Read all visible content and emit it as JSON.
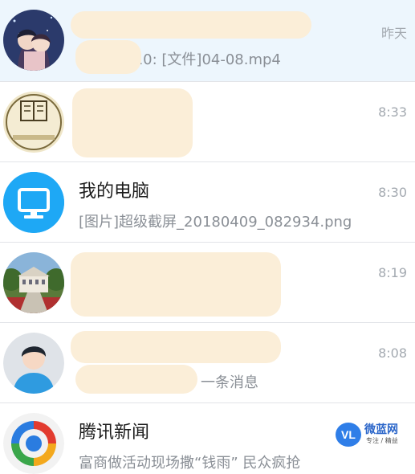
{
  "conversations": [
    {
      "title": "",
      "preview": "20142210: [文件]04-08.mp4",
      "time": "昨天",
      "avatar_icon": "anime-couple-avatar-icon"
    },
    {
      "title": "",
      "preview": "",
      "time": "8:33",
      "avatar_icon": "book-club-logo-icon",
      "avatar_text": "敬思书社"
    },
    {
      "title": "我的电脑",
      "preview": "[图片]超级截屏_20180409_082934.png",
      "time": "8:30",
      "avatar_icon": "monitor-icon"
    },
    {
      "title": "",
      "preview": "",
      "time": "8:19",
      "avatar_icon": "campus-building-avatar-icon"
    },
    {
      "title": "",
      "preview": "一条消息",
      "time": "8:08",
      "avatar_icon": "default-person-avatar-icon"
    },
    {
      "title": "腾讯新闻",
      "preview": "富商做活动现场撒“钱雨” 民众疯抢",
      "time": "",
      "avatar_icon": "tencent-news-icon"
    }
  ],
  "watermark": {
    "badge": "VL",
    "name": "微蓝网",
    "sub": "专注 / 精益"
  },
  "colors": {
    "selected_row_bg": "#edf6fd",
    "monitor_bg": "#1ea8f5",
    "divider": "#e2e4e8"
  }
}
